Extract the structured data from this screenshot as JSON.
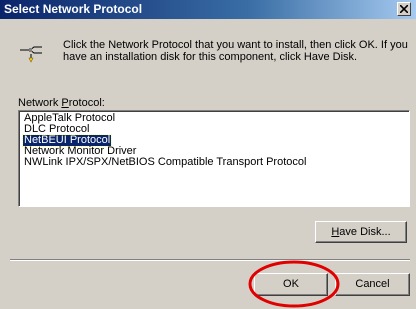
{
  "window": {
    "title": "Select Network Protocol",
    "close_label": "×"
  },
  "intro_text": "Click the Network Protocol that you want to install, then click OK. If you have an installation disk for this component, click Have Disk.",
  "protocol_list": {
    "label_prefix": "Network ",
    "label_accel": "P",
    "label_suffix": "rotocol:",
    "items": [
      "AppleTalk Protocol",
      "DLC Protocol",
      "NetBEUI Protocol",
      "Network Monitor Driver",
      "NWLink IPX/SPX/NetBIOS Compatible Transport Protocol"
    ],
    "selected": "NetBEUI Protocol"
  },
  "buttons": {
    "have_disk_accel": "H",
    "have_disk_rest": "ave Disk...",
    "ok": "OK",
    "cancel": "Cancel"
  },
  "colors": {
    "annotation_circle": "#e00000",
    "selection": "#0a246a",
    "face": "#d4d0c8"
  },
  "icons": {
    "title_close": "close-icon",
    "network": "network-component-icon"
  }
}
